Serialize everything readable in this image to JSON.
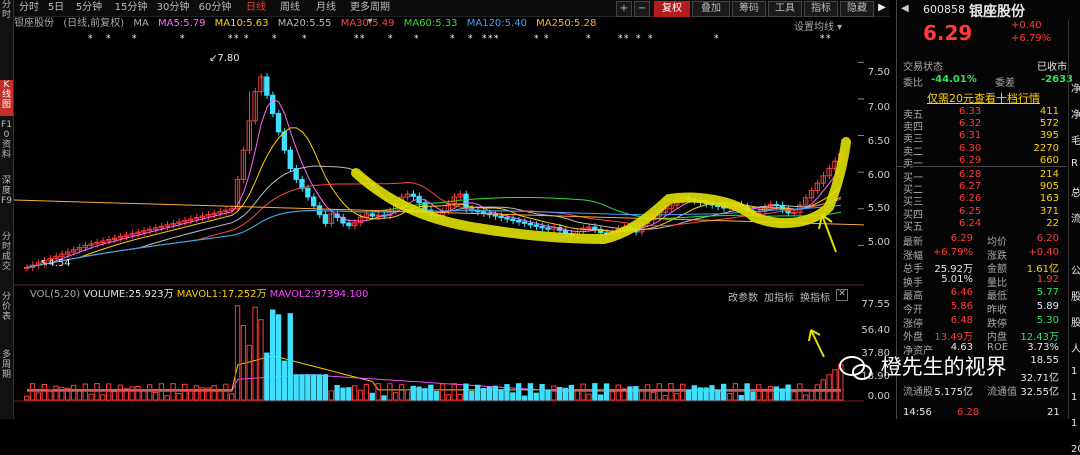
{
  "sidebar": {
    "items": [
      {
        "label": "分时",
        "active": false
      },
      {
        "label": "K线图",
        "active": true
      },
      {
        "label": "F10资料",
        "active": false
      },
      {
        "label": "深度F9",
        "active": false
      },
      {
        "label": "分时成交",
        "active": false
      },
      {
        "label": "分价表",
        "active": false
      },
      {
        "label": "多周期",
        "active": false
      }
    ]
  },
  "toolbar": {
    "periods": [
      "分时",
      "5日",
      "5分钟",
      "15分钟",
      "30分钟",
      "60分钟",
      "日线",
      "周线",
      "月线",
      "更多周期"
    ],
    "active_period": "日线",
    "plus": "+",
    "minus": "−",
    "right_buttons": [
      "复权",
      "叠加",
      "筹码",
      "工具",
      "指标",
      "隐藏"
    ],
    "arrow_left": "◀",
    "arrow_right": "▶"
  },
  "ma_bar": {
    "stock": "银座股份",
    "adjust": "(日线,前复权)",
    "ma_label": "MA",
    "items": [
      {
        "text": "MA5:5.79",
        "color": "#ff66ff"
      },
      {
        "text": "MA10:5.63",
        "color": "#ffd200"
      },
      {
        "text": "MA20:5.55",
        "color": "#bbbbbb"
      },
      {
        "text": "MA30:5.49",
        "color": "#ff4444"
      },
      {
        "text": "MA60:5.33",
        "color": "#33dd33"
      },
      {
        "text": "MA120:5.40",
        "color": "#3fa0ff"
      },
      {
        "text": "MA250:5.28",
        "color": "#ffaa33"
      }
    ],
    "settings": "设置均线"
  },
  "price_axis": [
    "7.50",
    "7.00",
    "6.50",
    "6.00",
    "5.50",
    "5.00"
  ],
  "annotations": {
    "high": "7.80",
    "low": "4.54"
  },
  "volume": {
    "header": "VOL(5,20)",
    "vol": "VOLUME:25.923万",
    "mavol1": "MAVOL1:17.252万",
    "mavol2": "MAVOL2:97394.100",
    "tools": [
      "改参数",
      "加指标",
      "换指标"
    ],
    "axis": [
      "77.55",
      "56.40",
      "37.80",
      "18.90",
      "0.00"
    ]
  },
  "chart_data": {
    "type": "candlestick",
    "y_axis_range": [
      4.5,
      7.9
    ],
    "volume_axis_range": [
      0,
      77.55
    ]
  },
  "quote": {
    "code": "600858",
    "name": "银座股份",
    "price": "6.29",
    "change": "+0.40",
    "change_pct": "+6.79%",
    "status_label": "交易状态",
    "status": "已收市",
    "weibi_label": "委比",
    "weibi": "-44.01%",
    "weicha_label": "委差",
    "weicha": "-2633",
    "promo": "仅需20元查看十档行情",
    "asks": [
      {
        "label": "卖五",
        "price": "6.33",
        "vol": "411"
      },
      {
        "label": "卖四",
        "price": "6.32",
        "vol": "572"
      },
      {
        "label": "卖三",
        "price": "6.31",
        "vol": "395"
      },
      {
        "label": "卖二",
        "price": "6.30",
        "vol": "2270"
      },
      {
        "label": "卖一",
        "price": "6.29",
        "vol": "660"
      }
    ],
    "bids": [
      {
        "label": "买一",
        "price": "6.28",
        "vol": "214"
      },
      {
        "label": "买二",
        "price": "6.27",
        "vol": "905"
      },
      {
        "label": "买三",
        "price": "6.26",
        "vol": "163"
      },
      {
        "label": "买四",
        "price": "6.25",
        "vol": "371"
      },
      {
        "label": "买五",
        "price": "6.24",
        "vol": "22"
      }
    ],
    "stats": [
      {
        "l1": "最新",
        "v1": "6.29",
        "c1": "red",
        "l2": "均价",
        "v2": "6.20",
        "c2": "red"
      },
      {
        "l1": "涨幅",
        "v1": "+6.79%",
        "c1": "red",
        "l2": "涨跌",
        "v2": "+0.40",
        "c2": "red"
      },
      {
        "l1": "总手",
        "v1": "25.92万",
        "c1": "white",
        "l2": "金额",
        "v2": "1.61亿",
        "c2": "yellow"
      },
      {
        "l1": "换手",
        "v1": "5.01%",
        "c1": "white",
        "l2": "量比",
        "v2": "1.92",
        "c2": "red"
      },
      {
        "l1": "最高",
        "v1": "6.46",
        "c1": "red",
        "l2": "最低",
        "v2": "5.77",
        "c2": "green"
      },
      {
        "l1": "今开",
        "v1": "5.86",
        "c1": "red",
        "l2": "昨收",
        "v2": "5.89",
        "c2": "white"
      },
      {
        "l1": "涨停",
        "v1": "6.48",
        "c1": "red",
        "l2": "跌停",
        "v2": "5.30",
        "c2": "green"
      },
      {
        "l1": "外盘",
        "v1": "13.49万",
        "c1": "red",
        "l2": "内盘",
        "v2": "12.43万",
        "c2": "green"
      },
      {
        "l1": "净资产",
        "v1": "4.63",
        "c1": "white",
        "l2": "ROE",
        "v2": "3.73%",
        "c2": "white"
      },
      {
        "l1": "",
        "v1": "",
        "c1": "white",
        "l2": "",
        "v2": "18.55",
        "c2": "white"
      },
      {
        "l1": "",
        "v1": "",
        "c1": "white",
        "l2": "",
        "v2": "32.71亿",
        "c2": "white"
      },
      {
        "l1": "流通股",
        "v1": "5.175亿",
        "c1": "white",
        "l2": "流通值",
        "v2": "32.55亿",
        "c2": "white"
      }
    ],
    "last_tick": {
      "time": "14:56",
      "price": "6.28",
      "vol": "21"
    },
    "side_letters": [
      "净",
      "净",
      "毛",
      "R",
      "总",
      "流",
      "",
      "公",
      "股",
      "股",
      "人",
      "1",
      "1",
      "1",
      "20"
    ]
  },
  "watermark": "橙先生的视界"
}
